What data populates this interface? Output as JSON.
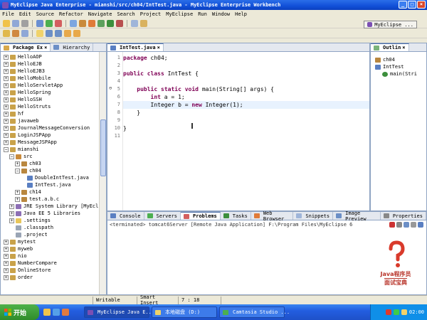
{
  "window": {
    "title": "MyEclipse Java Enterprise - mianshi/src/ch04/IntTest.java - MyEclipse Enterprise Workbench"
  },
  "menu": [
    "File",
    "Edit",
    "Source",
    "Refactor",
    "Navigate",
    "Search",
    "Project",
    "MyEclipse",
    "Run",
    "Window",
    "Help"
  ],
  "perspective": {
    "label": "MyEclipse ..."
  },
  "package_explorer": {
    "tabs": [
      "Package Ex",
      "Hierarchy"
    ],
    "items": [
      {
        "label": "HelloAOP",
        "level": 0,
        "kind": "project"
      },
      {
        "label": "HelloEJB",
        "level": 0,
        "kind": "project"
      },
      {
        "label": "HelloEJB3",
        "level": 0,
        "kind": "project"
      },
      {
        "label": "HelloMobile",
        "level": 0,
        "kind": "project"
      },
      {
        "label": "HelloServletApp",
        "level": 0,
        "kind": "project"
      },
      {
        "label": "HelloSpring",
        "level": 0,
        "kind": "project"
      },
      {
        "label": "HelloSSH",
        "level": 0,
        "kind": "project"
      },
      {
        "label": "HelloStruts",
        "level": 0,
        "kind": "project"
      },
      {
        "label": "hf",
        "level": 0,
        "kind": "project"
      },
      {
        "label": "javaweb",
        "level": 0,
        "kind": "project"
      },
      {
        "label": "JournalMessageConversion",
        "level": 0,
        "kind": "project"
      },
      {
        "label": "LoginJSPApp",
        "level": 0,
        "kind": "project"
      },
      {
        "label": "MessageJSPApp",
        "level": 0,
        "kind": "project"
      },
      {
        "label": "mianshi",
        "level": 0,
        "kind": "project",
        "expanded": true
      },
      {
        "label": "src",
        "level": 1,
        "kind": "srcfolder",
        "expanded": true
      },
      {
        "label": "ch03",
        "level": 2,
        "kind": "package",
        "expander": "+"
      },
      {
        "label": "ch04",
        "level": 2,
        "kind": "package",
        "expanded": true
      },
      {
        "label": "DoubleIntTest.java",
        "level": 3,
        "kind": "java"
      },
      {
        "label": "IntTest.java",
        "level": 3,
        "kind": "java"
      },
      {
        "label": "ch14",
        "level": 2,
        "kind": "package",
        "expander": "+"
      },
      {
        "label": "test.a.b.c",
        "level": 2,
        "kind": "package",
        "expander": "+"
      },
      {
        "label": "JRE System Library [MyEclip",
        "level": 1,
        "kind": "library",
        "expander": "+"
      },
      {
        "label": "Java EE 5 Libraries",
        "level": 1,
        "kind": "library",
        "expander": "+"
      },
      {
        "label": ".settings",
        "level": 1,
        "kind": "folder",
        "expander": "+"
      },
      {
        "label": ".classpath",
        "level": 1,
        "kind": "file"
      },
      {
        "label": ".project",
        "level": 1,
        "kind": "file"
      },
      {
        "label": "mytest",
        "level": 0,
        "kind": "project"
      },
      {
        "label": "myweb",
        "level": 0,
        "kind": "project"
      },
      {
        "label": "nio",
        "level": 0,
        "kind": "project"
      },
      {
        "label": "NumberCompare",
        "level": 0,
        "kind": "project"
      },
      {
        "label": "OnlineStore",
        "level": 0,
        "kind": "project"
      },
      {
        "label": "order",
        "level": 0,
        "kind": "project"
      }
    ]
  },
  "editor": {
    "tab": "IntTest.java",
    "lines": [
      {
        "n": "1",
        "parts": [
          [
            "kw",
            "package"
          ],
          [
            "t",
            " ch04;"
          ]
        ]
      },
      {
        "n": "2",
        "parts": []
      },
      {
        "n": "3",
        "parts": [
          [
            "kw",
            "public"
          ],
          [
            "t",
            " "
          ],
          [
            "kw",
            "class"
          ],
          [
            "t",
            " IntTest {"
          ]
        ]
      },
      {
        "n": "4",
        "parts": []
      },
      {
        "n": "5",
        "parts": [
          [
            "t",
            "    "
          ],
          [
            "kw",
            "public"
          ],
          [
            "t",
            " "
          ],
          [
            "kw",
            "static"
          ],
          [
            "t",
            " "
          ],
          [
            "kw",
            "void"
          ],
          [
            "t",
            " main(String[] args) {"
          ]
        ]
      },
      {
        "n": "6",
        "parts": [
          [
            "t",
            "        "
          ],
          [
            "kw",
            "int"
          ],
          [
            "t",
            " a = 1;"
          ]
        ]
      },
      {
        "n": "7",
        "parts": [
          [
            "t",
            "        Integer b = "
          ],
          [
            "kw",
            "new"
          ],
          [
            "t",
            " Integer(1);"
          ]
        ],
        "highlight": true
      },
      {
        "n": "8",
        "parts": [
          [
            "t",
            "    }"
          ]
        ]
      },
      {
        "n": "9",
        "parts": []
      },
      {
        "n": "10",
        "parts": [
          [
            "t",
            "}"
          ]
        ]
      },
      {
        "n": "11",
        "parts": []
      }
    ]
  },
  "outline": {
    "tab": "Outlin",
    "items": [
      {
        "label": "ch04",
        "level": 0
      },
      {
        "label": "IntTest",
        "level": 0
      },
      {
        "label": "main(Stri",
        "level": 1
      }
    ]
  },
  "console": {
    "tabs": [
      "Console",
      "Servers",
      "Problems",
      "Tasks",
      "Web Browser",
      "Snippets",
      "Image Preview",
      "Properties"
    ],
    "header": "<terminated> tomcat6Server [Remote Java Application] F:\\Program Files\\MyEclipse 6"
  },
  "watermark": {
    "line1": "Java程序员",
    "line2": "面试宝典"
  },
  "status": {
    "mode": "Writable",
    "insert": "Smart Insert",
    "position": "7 : 18"
  },
  "taskbar": {
    "start": "开始",
    "tasks": [
      "MyEclipse Java E...",
      "本地磁盘 (D:)",
      "Camtasia Studio ..."
    ],
    "clock": "02:00"
  },
  "colors": {
    "keyword": "#7f0055",
    "title_bar": "#1150d8",
    "highlight_line": "#e8f2fe"
  }
}
